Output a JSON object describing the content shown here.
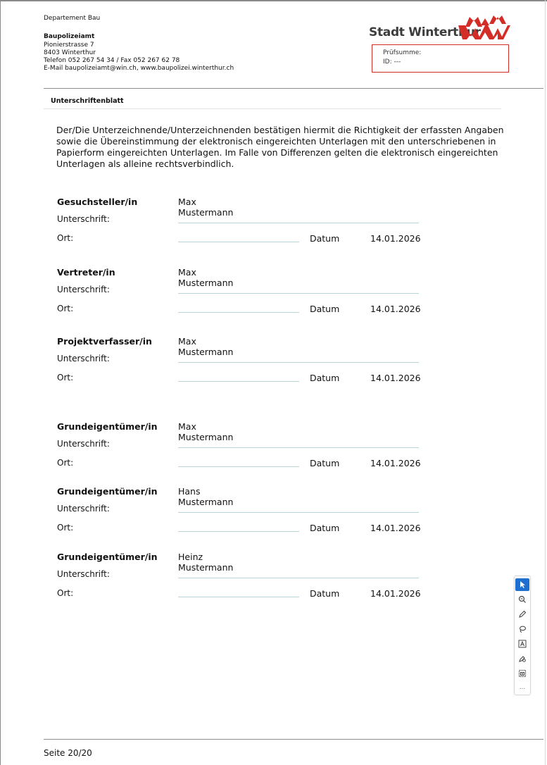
{
  "header": {
    "department": "Departement Bau",
    "office": "Baupolizeiamt",
    "street": "Pionierstrasse 7",
    "city": "8403 Winterthur",
    "phone": "Telefon 052 267 54 34 / Fax 052 267 62 78",
    "email": "E-Mail baupolizeiamt@win.ch, www.baupolizei.winterthur.ch"
  },
  "logo": {
    "text": "Stadt Winterthur",
    "color": "#d32d27"
  },
  "checksum_box": {
    "pruefsumme_label": "Prüfsumme:",
    "id_label": "ID: ---",
    "border_color": "#d32d27"
  },
  "section_title": "Unterschriftenblatt",
  "intro_text": "Der/Die Unterzeichnende/Unterzeichnenden bestätigen hiermit die Richtigkeit der erfassten Angaben sowie die Übereinstimmung der elektronisch eingereichten Unterlagen mit den unterschriebenen in Papierform eingereichten Unterlagen. Im Falle von Differenzen gelten die elektronisch eingereichten Unterlagen als alleine rechtsverbindlich.",
  "labels": {
    "signature": "Unterschrift:",
    "place": "Ort:",
    "date": "Datum"
  },
  "blocks": [
    {
      "role": "Gesuchsteller/in",
      "first_name": "Max",
      "last_name": "Mustermann",
      "date": "14.01.2026"
    },
    {
      "role": "Vertreter/in",
      "first_name": "Max",
      "last_name": "Mustermann",
      "date": "14.01.2026"
    },
    {
      "role": "Projektverfasser/in",
      "first_name": "Max",
      "last_name": "Mustermann",
      "date": "14.01.2026"
    },
    {
      "role": "Grundeigentümer/in",
      "first_name": "Max",
      "last_name": "Mustermann",
      "date": "14.01.2026"
    },
    {
      "role": "Grundeigentümer/in",
      "first_name": "Hans",
      "last_name": "Mustermann",
      "date": "14.01.2026"
    },
    {
      "role": "Grundeigentümer/in",
      "first_name": "Heinz",
      "last_name": "Mustermann",
      "date": "14.01.2026"
    }
  ],
  "footer": {
    "page": "Seite 20/20"
  },
  "toolbar": {
    "tools": [
      "select-icon",
      "zoom-icon",
      "pen-icon",
      "lasso-icon",
      "text-box-icon",
      "stamp-icon",
      "snapshot-icon",
      "more-icon"
    ],
    "more_label": "...",
    "accent": "#1f6fd0"
  }
}
